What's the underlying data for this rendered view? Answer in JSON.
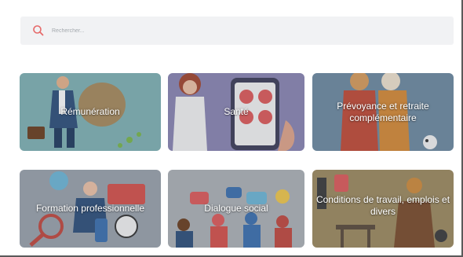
{
  "search": {
    "placeholder": "Rechercher..."
  },
  "colors": {
    "accent": "#e66a6a",
    "search_bg": "#f1f2f4"
  },
  "cards": [
    {
      "label": "Rémunération",
      "icon": "salary-illustration"
    },
    {
      "label": "Santé",
      "icon": "health-illustration"
    },
    {
      "label": "Prévoyance et retraite complémentaire",
      "icon": "pension-illustration"
    },
    {
      "label": "Formation professionnelle",
      "icon": "training-illustration"
    },
    {
      "label": "Dialogue social",
      "icon": "social-dialogue-illustration"
    },
    {
      "label": "Conditions de travail, emplois et divers",
      "icon": "working-conditions-illustration"
    }
  ]
}
